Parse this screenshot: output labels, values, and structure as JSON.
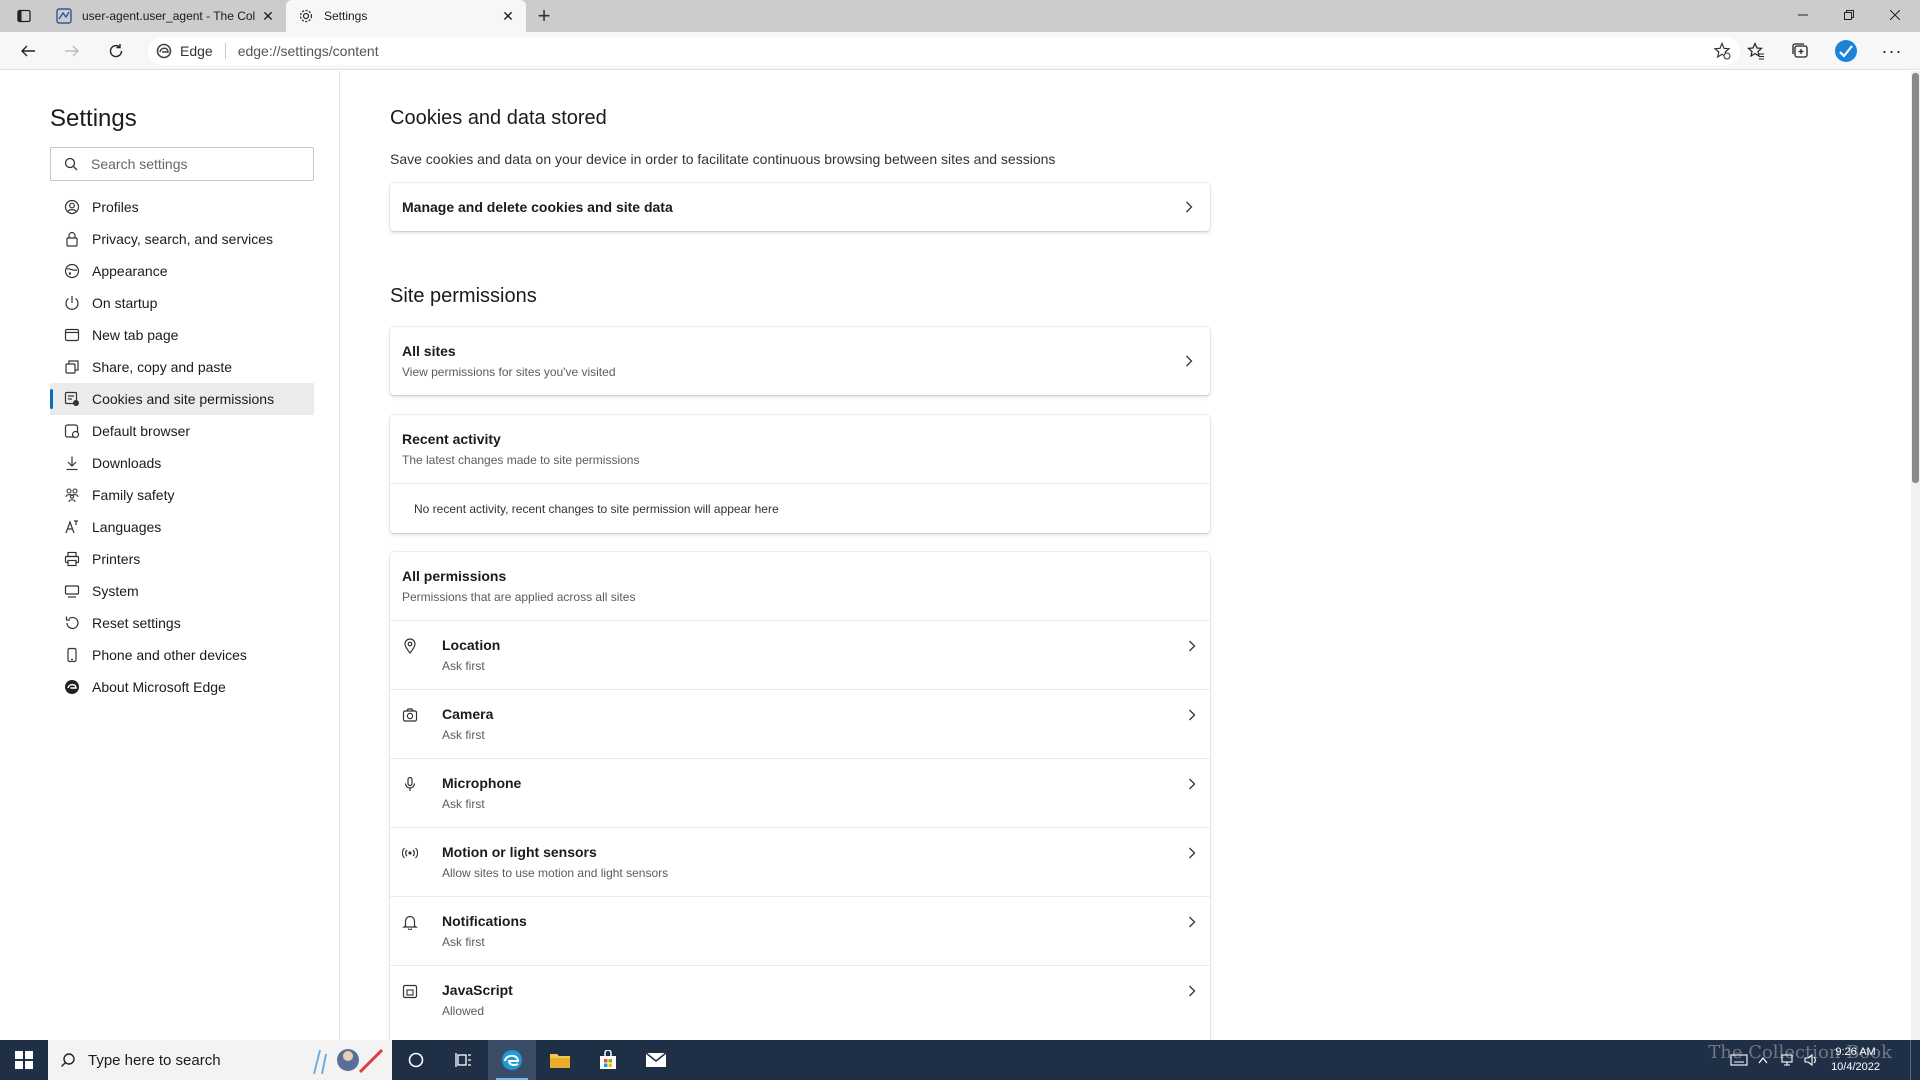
{
  "browser": {
    "tabs": [
      {
        "title": "user-agent.user_agent - The Coll",
        "active": false
      },
      {
        "title": "Settings",
        "active": true
      }
    ],
    "site_identity": "Edge",
    "url": "edge://settings/content"
  },
  "sidebar": {
    "title": "Settings",
    "search_placeholder": "Search settings",
    "items": [
      {
        "label": "Profiles",
        "icon": "profile-icon"
      },
      {
        "label": "Privacy, search, and services",
        "icon": "lock-icon"
      },
      {
        "label": "Appearance",
        "icon": "appearance-icon"
      },
      {
        "label": "On startup",
        "icon": "power-icon"
      },
      {
        "label": "New tab page",
        "icon": "newtab-icon"
      },
      {
        "label": "Share, copy and paste",
        "icon": "share-icon"
      },
      {
        "label": "Cookies and site permissions",
        "icon": "cookie-permissions-icon",
        "active": true
      },
      {
        "label": "Default browser",
        "icon": "browser-icon"
      },
      {
        "label": "Downloads",
        "icon": "download-icon"
      },
      {
        "label": "Family safety",
        "icon": "family-icon"
      },
      {
        "label": "Languages",
        "icon": "language-icon"
      },
      {
        "label": "Printers",
        "icon": "printer-icon"
      },
      {
        "label": "System",
        "icon": "system-icon"
      },
      {
        "label": "Reset settings",
        "icon": "reset-icon"
      },
      {
        "label": "Phone and other devices",
        "icon": "phone-icon"
      },
      {
        "label": "About Microsoft Edge",
        "icon": "edge-icon"
      }
    ]
  },
  "main": {
    "cookies": {
      "title": "Cookies and data stored",
      "description": "Save cookies and data on your device in order to facilitate continuous browsing between sites and sessions",
      "manage_label": "Manage and delete cookies and site data"
    },
    "site_permissions": {
      "title": "Site permissions",
      "all_sites": {
        "title": "All sites",
        "subtitle": "View permissions for sites you've visited"
      },
      "recent": {
        "title": "Recent activity",
        "subtitle": "The latest changes made to site permissions",
        "empty": "No recent activity, recent changes to site permission will appear here"
      },
      "all_permissions": {
        "title": "All permissions",
        "subtitle": "Permissions that are applied across all sites",
        "items": [
          {
            "title": "Location",
            "status": "Ask first",
            "icon": "location-icon"
          },
          {
            "title": "Camera",
            "status": "Ask first",
            "icon": "camera-icon"
          },
          {
            "title": "Microphone",
            "status": "Ask first",
            "icon": "microphone-icon"
          },
          {
            "title": "Motion or light sensors",
            "status": "Allow sites to use motion and light sensors",
            "icon": "sensor-icon"
          },
          {
            "title": "Notifications",
            "status": "Ask first",
            "icon": "bell-icon"
          },
          {
            "title": "JavaScript",
            "status": "Allowed",
            "icon": "javascript-icon"
          }
        ]
      }
    }
  },
  "taskbar": {
    "search_placeholder": "Type here to search",
    "time": "9:26 AM",
    "date": "10/4/2022",
    "watermark": "The Collection Book"
  },
  "colors": {
    "accent": "#0f6cbd",
    "taskbar": "#1f2f45",
    "tabstrip": "#cccccc"
  }
}
